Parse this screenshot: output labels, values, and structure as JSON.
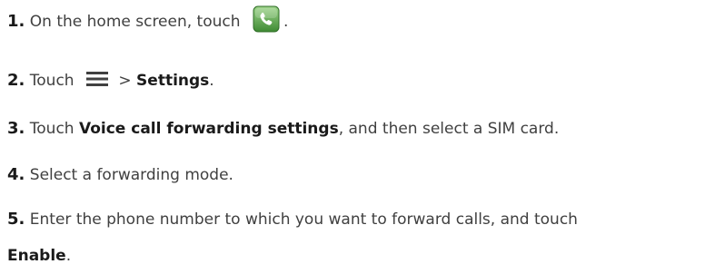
{
  "steps": [
    {
      "number": "1.",
      "text_before": "On the home screen, touch",
      "icon": "phone-app-icon",
      "text_after": "."
    },
    {
      "number": "2.",
      "text_before": "Touch",
      "icon": "menu-icon",
      "separator": ">",
      "bold": "Settings",
      "text_after": "."
    },
    {
      "number": "3.",
      "text_before": "Touch",
      "bold": "Voice call forwarding settings",
      "text_after": ", and then select a SIM card."
    },
    {
      "number": "4.",
      "text": "Select a forwarding mode."
    },
    {
      "number": "5.",
      "text": "Enter the phone number to which you want to forward calls, and touch",
      "bold_line2": "Enable",
      "text_after": "."
    }
  ],
  "colors": {
    "text": "#404040",
    "emphasis": "#1a1a1a",
    "icon_green": "#4a9a3a"
  }
}
